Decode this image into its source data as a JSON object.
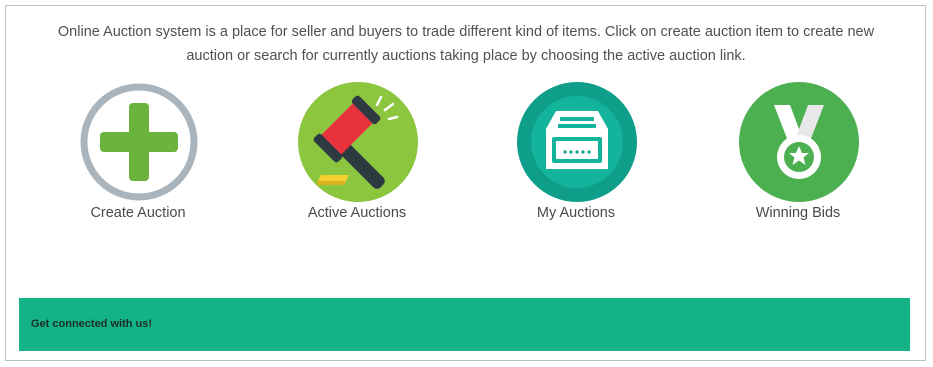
{
  "intro": {
    "line1": "Online Auction system is a place for seller and buyers to trade different kind of items. Click on create auction item to create new",
    "line2": "auction or search for currently auctions taking place by choosing the active auction link."
  },
  "tiles": [
    {
      "label": "Create Auction",
      "icon": "plus-circle-icon"
    },
    {
      "label": "Active Auctions",
      "icon": "gavel-icon"
    },
    {
      "label": "My Auctions",
      "icon": "inbox-tray-icon"
    },
    {
      "label": "Winning Bids",
      "icon": "medal-icon"
    }
  ],
  "footer": {
    "text": "Get connected with us!"
  },
  "colors": {
    "footer_green": "#14b287",
    "plus_green": "#6ab33c",
    "ring_grey": "#a9b4bd",
    "gavel_bg": "#8cc63f",
    "inbox_bg": "#0f9e8a",
    "medal_bg": "#4caf50"
  }
}
